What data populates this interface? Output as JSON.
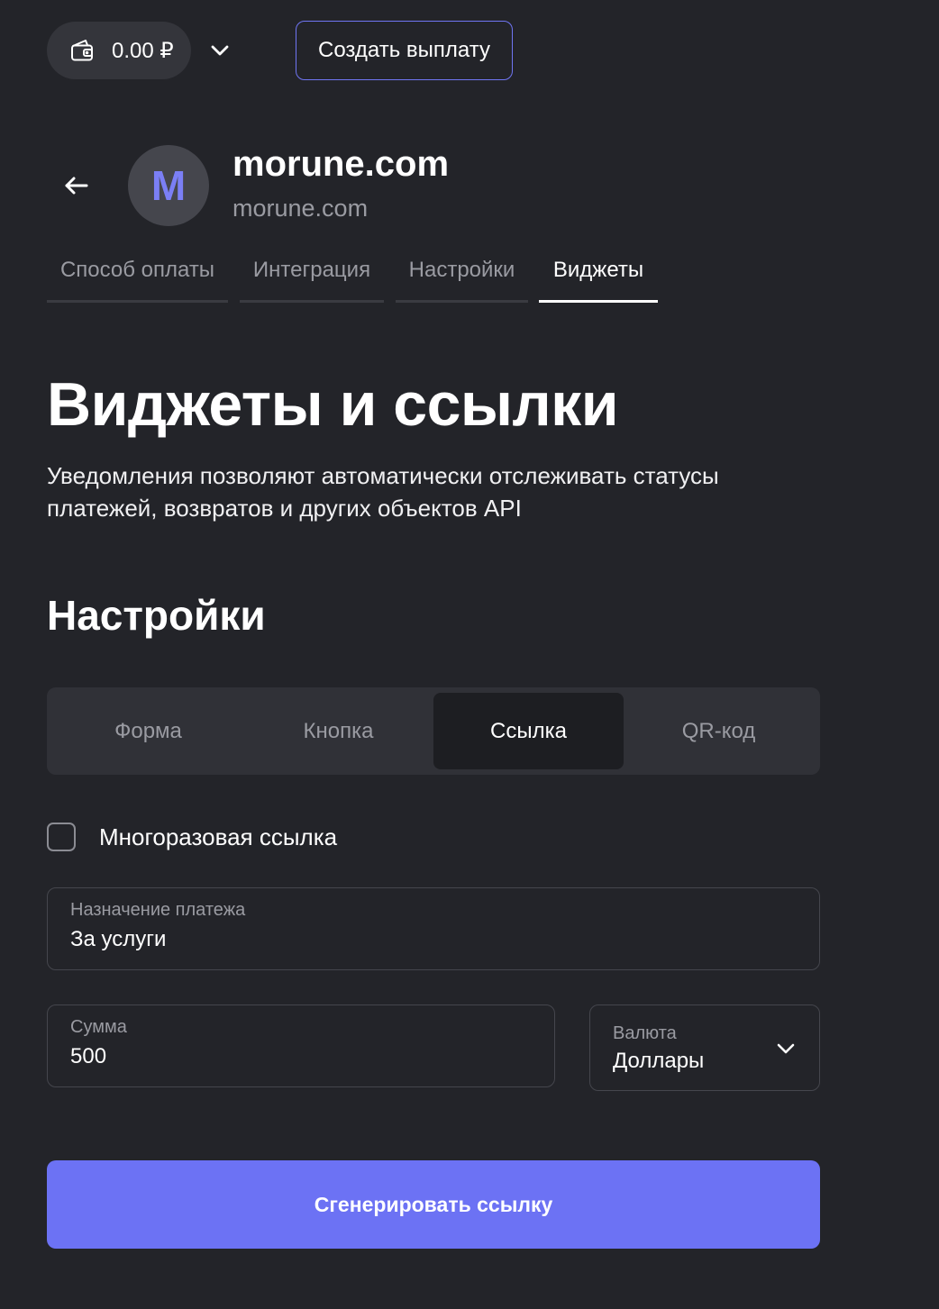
{
  "topbar": {
    "balance": "0.00 ₽",
    "payout_label": "Создать выплату"
  },
  "header": {
    "avatar_letter": "M",
    "title": "morune.com",
    "subtitle": "morune.com"
  },
  "tabs": [
    {
      "label": "Способ оплаты",
      "active": false
    },
    {
      "label": "Интеграция",
      "active": false
    },
    {
      "label": "Настройки",
      "active": false
    },
    {
      "label": "Виджеты",
      "active": true
    }
  ],
  "main": {
    "heading": "Виджеты и ссылки",
    "description": "Уведомления позволяют автоматически отслеживать статусы платежей, возвратов и других объектов API",
    "section_heading": "Настройки"
  },
  "segments": [
    {
      "label": "Форма",
      "active": false
    },
    {
      "label": "Кнопка",
      "active": false
    },
    {
      "label": "Ссылка",
      "active": true
    },
    {
      "label": "QR-код",
      "active": false
    }
  ],
  "form": {
    "reusable_label": "Многоразовая ссылка",
    "reusable_checked": false,
    "purpose_label": "Назначение платежа",
    "purpose_value": "За услуги",
    "amount_label": "Сумма",
    "amount_value": "500",
    "currency_label": "Валюта",
    "currency_value": "Доллары",
    "generate_label": "Сгенерировать ссылку"
  },
  "colors": {
    "background": "#232429",
    "accent": "#6c72f4",
    "muted_text": "#9a9ba2"
  },
  "icons": {
    "wallet": "wallet-icon",
    "chevron": "chevron-down-icon",
    "back": "arrow-left-icon"
  }
}
